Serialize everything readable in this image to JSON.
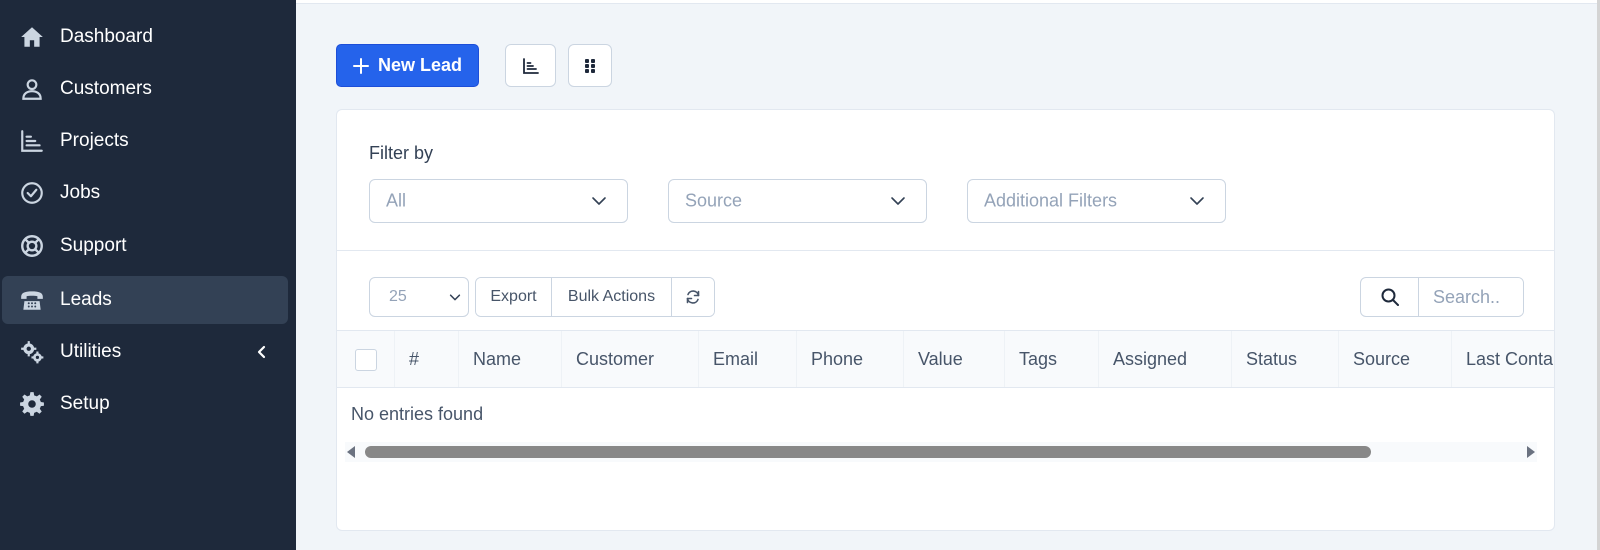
{
  "sidebar": {
    "items": [
      {
        "label": "Dashboard",
        "icon": "home-icon"
      },
      {
        "label": "Customers",
        "icon": "user-icon"
      },
      {
        "label": "Projects",
        "icon": "bar-chart-icon"
      },
      {
        "label": "Jobs",
        "icon": "check-circle-icon"
      },
      {
        "label": "Support",
        "icon": "life-ring-icon"
      },
      {
        "label": "Leads",
        "icon": "phone-icon",
        "active": true
      },
      {
        "label": "Utilities",
        "icon": "cogs-icon",
        "expandable": true
      },
      {
        "label": "Setup",
        "icon": "gear-icon"
      }
    ]
  },
  "toolbar": {
    "new_lead_label": "New Lead",
    "summary_icon": "bar-chart-icon",
    "kanban_icon": "grid-dots-icon"
  },
  "filters": {
    "label": "Filter by",
    "status_value": "All",
    "source_placeholder": "Source",
    "additional_placeholder": "Additional Filters"
  },
  "table_controls": {
    "per_page": "25",
    "export_label": "Export",
    "bulk_actions_label": "Bulk Actions",
    "search_placeholder": "Search.."
  },
  "table": {
    "columns": [
      "#",
      "Name",
      "Customer",
      "Email",
      "Phone",
      "Value",
      "Tags",
      "Assigned",
      "Status",
      "Source",
      "Last Conta"
    ],
    "empty_text": "No entries found"
  },
  "colors": {
    "sidebar_bg": "#1e293b",
    "sidebar_active": "#334155",
    "primary": "#2563eb",
    "page_bg": "#f1f5f9"
  }
}
